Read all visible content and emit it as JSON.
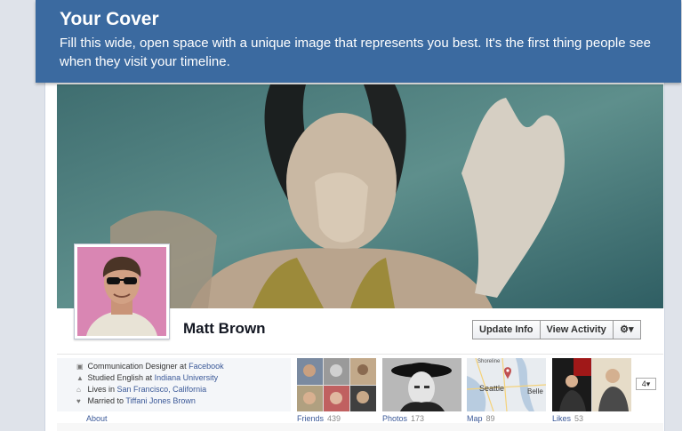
{
  "banner": {
    "title": "Your Cover",
    "text": "Fill this wide, open space with a unique image that represents you best. It's the first thing people see when they visit your timeline."
  },
  "profile": {
    "name": "Matt Brown"
  },
  "actions": {
    "update_info": "Update Info",
    "view_activity": "View Activity",
    "settings_icon": "gear-icon"
  },
  "about": {
    "items": [
      {
        "icon": "briefcase-icon",
        "prefix": "Communication Designer at ",
        "link": "Facebook"
      },
      {
        "icon": "graduation-cap-icon",
        "prefix": "Studied English at ",
        "link": "Indiana University"
      },
      {
        "icon": "home-icon",
        "prefix": "Lives in ",
        "link": "San Francisco, California"
      },
      {
        "icon": "heart-icon",
        "prefix": "Married to ",
        "link": "Tiffani Jones Brown"
      }
    ],
    "label": "About"
  },
  "tiles": [
    {
      "label": "Friends",
      "count": "439"
    },
    {
      "label": "Photos",
      "count": "173"
    },
    {
      "label": "Map",
      "count": "89"
    },
    {
      "label": "Likes",
      "count": "53"
    }
  ],
  "map_labels": {
    "a": "Shoreline",
    "b": "Seattle",
    "c": "Belle"
  },
  "more_select": "4",
  "colors": {
    "banner": "#3b6aa0",
    "link": "#3b5998"
  }
}
